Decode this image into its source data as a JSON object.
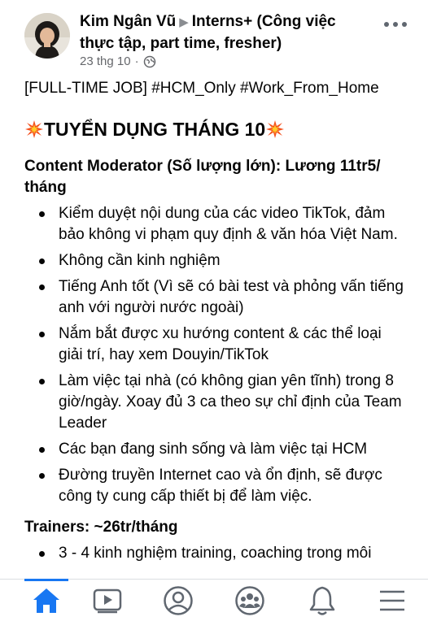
{
  "post": {
    "author": "Kim Ngân Vũ",
    "group": "Interns+ (Công việc thực tập, part time, fresher)",
    "date": "23 thg 10",
    "audience_icon": "globe-icon",
    "more_icon": "more-horizontal-icon"
  },
  "content": {
    "tag_line": "[FULL-TIME JOB] #HCM_Only #Work_From_Home",
    "headline": "TUYỂN DỤNG THÁNG 10",
    "headline_icon": "collision-emoji",
    "section1_title": "Content Moderator (Số lượng lớn): Lương 11tr5/ tháng",
    "section1_items": [
      "Kiểm duyệt nội dung của các video TikTok, đảm bảo không vi phạm quy định & văn hóa Việt Nam.",
      "Không cần kinh nghiệm",
      "Tiếng Anh tốt (Vì sẽ có bài test và phỏng vấn tiếng anh với người nước ngoài)",
      "Nắm bắt được xu hướng content & các thể loại giải trí, hay xem Douyin/TikTok",
      "Làm việc tại nhà (có không gian yên tĩnh) trong 8 giờ/ngày. Xoay đủ 3 ca theo sự chỉ định của Team Leader",
      "Các bạn đang sinh sống và làm việc tại HCM",
      "Đường truyền Internet cao và ổn định, sẽ được công ty cung cấp thiết bị để làm việc."
    ],
    "section2_title": "Trainers: ~26tr/tháng",
    "section2_items": [
      "3 - 4 kinh nghiệm training, coaching trong môi"
    ]
  },
  "tab_bar": {
    "active": "home",
    "tabs": [
      {
        "id": "home",
        "icon": "home-icon"
      },
      {
        "id": "watch",
        "icon": "video-icon"
      },
      {
        "id": "profile",
        "icon": "profile-icon"
      },
      {
        "id": "groups",
        "icon": "groups-icon"
      },
      {
        "id": "notifications",
        "icon": "bell-icon"
      },
      {
        "id": "menu",
        "icon": "menu-icon"
      }
    ]
  },
  "colors": {
    "accent": "#1877f2",
    "text": "#050505",
    "secondary_text": "#65676b",
    "icon_gray": "#606770"
  }
}
